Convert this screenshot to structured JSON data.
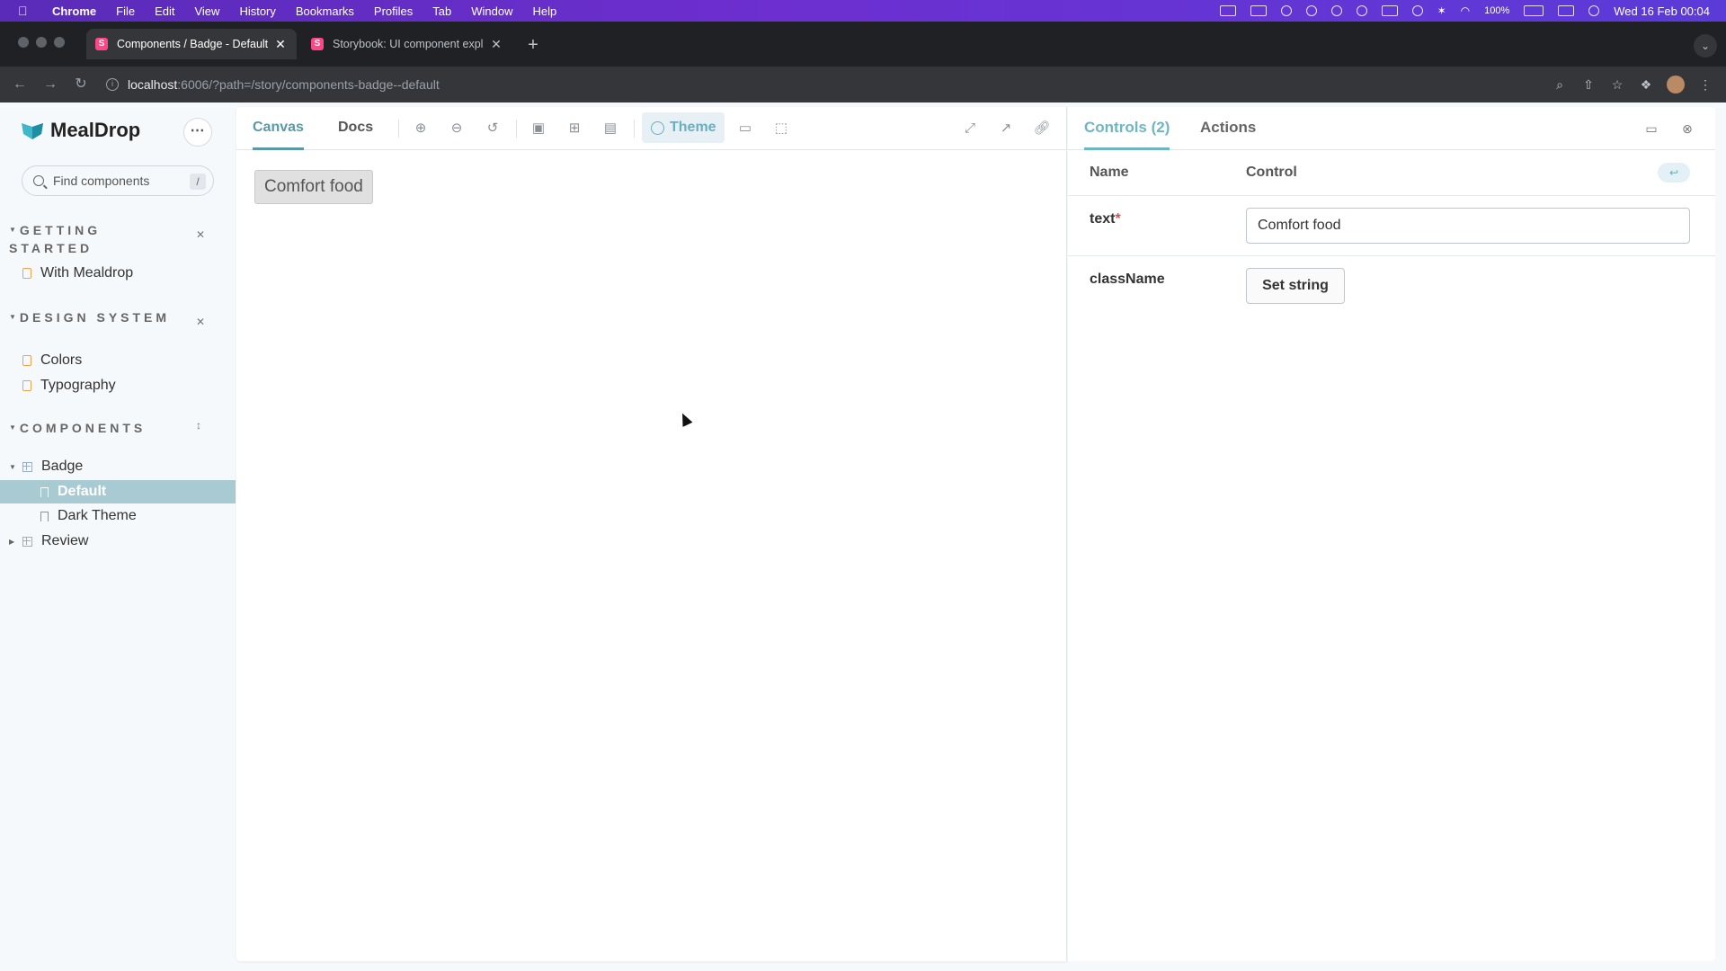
{
  "menubar": {
    "app": "Chrome",
    "items": [
      "File",
      "Edit",
      "View",
      "History",
      "Bookmarks",
      "Profiles",
      "Tab",
      "Window",
      "Help"
    ],
    "battery": "100%",
    "datetime": "Wed 16 Feb  00:04"
  },
  "browser": {
    "tabs": [
      {
        "title": "Components / Badge - Default",
        "active": true
      },
      {
        "title": "Storybook: UI component expl",
        "active": false
      }
    ],
    "url_host": "localhost",
    "url_path": ":6006/?path=/story/components-badge--default"
  },
  "sidebar": {
    "brand": "MealDrop",
    "search_placeholder": "Find components",
    "search_shortcut": "/",
    "groups": [
      {
        "title": "GETTING STARTED",
        "items": [
          "With Mealdrop"
        ]
      },
      {
        "title": "DESIGN SYSTEM",
        "items": [
          "Colors",
          "Typography"
        ]
      },
      {
        "title": "COMPONENTS"
      }
    ],
    "components": {
      "badge": "Badge",
      "default": "Default",
      "dark_theme": "Dark Theme",
      "review": "Review"
    }
  },
  "canvas": {
    "tabs": [
      "Canvas",
      "Docs"
    ],
    "theme_label": "Theme",
    "badge_text": "Comfort food"
  },
  "controls": {
    "tabs": [
      "Controls (2)",
      "Actions"
    ],
    "col_name": "Name",
    "col_control": "Control",
    "rows": [
      {
        "name": "text",
        "required": "*",
        "value": "Comfort food"
      },
      {
        "name": "className",
        "button": "Set string"
      }
    ]
  }
}
